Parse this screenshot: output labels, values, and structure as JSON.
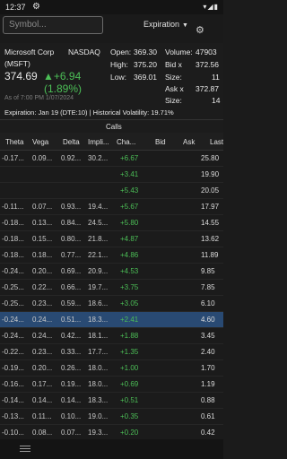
{
  "status": {
    "time": "12:37",
    "right": "▾◢▮"
  },
  "search": {
    "placeholder": "Symbol..."
  },
  "expiration": {
    "label": "Expiration"
  },
  "quote": {
    "company": "Microsoft Corp",
    "exchange": "NASDAQ",
    "ticker": "(MSFT)",
    "price": "374.69",
    "change": "▲+6.94",
    "change_pct": "(1.89%)",
    "asof": "As of  7:00 PM 1/07/2024",
    "open_label": "Open:",
    "open": "369.30",
    "high_label": "High:",
    "high": "375.20",
    "low_label": "Low:",
    "low": "369.01",
    "volume_label": "Volume:",
    "volume": "47903",
    "bid_label": "Bid x",
    "bid": "372.56",
    "size_label": "Size:",
    "size1": "11",
    "ask_label": "Ask x",
    "ask": "372.87",
    "size2": "14",
    "expiration_info": "Expiration: Jan 19 (DTE:10) | Historical Volatility: 19.71%"
  },
  "table": {
    "section": "Calls",
    "headers": [
      "Theta",
      "Vega",
      "Delta",
      "Impli...",
      "Cha...",
      "Bid",
      "Ask",
      "Last"
    ],
    "rows": [
      {
        "theta": "-0.17...",
        "vega": "0.09...",
        "delta": "0.92...",
        "iv": "30.2...",
        "chg": "+6.67",
        "last": "25.80"
      },
      {
        "theta": "",
        "vega": "",
        "delta": "",
        "iv": "",
        "chg": "+3.41",
        "last": "19.90"
      },
      {
        "theta": "",
        "vega": "",
        "delta": "",
        "iv": "",
        "chg": "+5.43",
        "last": "20.05"
      },
      {
        "theta": "-0.11...",
        "vega": "0.07...",
        "delta": "0.93...",
        "iv": "19.4...",
        "chg": "+5.67",
        "last": "17.97"
      },
      {
        "theta": "-0.18...",
        "vega": "0.13...",
        "delta": "0.84...",
        "iv": "24.5...",
        "chg": "+5.80",
        "last": "14.55"
      },
      {
        "theta": "-0.18...",
        "vega": "0.15...",
        "delta": "0.80...",
        "iv": "21.8...",
        "chg": "+4.87",
        "last": "13.62"
      },
      {
        "theta": "-0.18...",
        "vega": "0.18...",
        "delta": "0.77...",
        "iv": "22.1...",
        "chg": "+4.86",
        "last": "11.89"
      },
      {
        "theta": "-0.24...",
        "vega": "0.20...",
        "delta": "0.69...",
        "iv": "20.9...",
        "chg": "+4.53",
        "last": "9.85"
      },
      {
        "theta": "-0.25...",
        "vega": "0.22...",
        "delta": "0.66...",
        "iv": "19.7...",
        "chg": "+3.75",
        "last": "7.85"
      },
      {
        "theta": "-0.25...",
        "vega": "0.23...",
        "delta": "0.59...",
        "iv": "18.6...",
        "chg": "+3.05",
        "last": "6.10"
      },
      {
        "theta": "-0.24...",
        "vega": "0.24...",
        "delta": "0.51...",
        "iv": "18.3...",
        "chg": "+2.41",
        "last": "4.60",
        "selected": true
      },
      {
        "theta": "-0.24...",
        "vega": "0.24...",
        "delta": "0.42...",
        "iv": "18.1...",
        "chg": "+1.88",
        "last": "3.45"
      },
      {
        "theta": "-0.22...",
        "vega": "0.23...",
        "delta": "0.33...",
        "iv": "17.7...",
        "chg": "+1.35",
        "last": "2.40"
      },
      {
        "theta": "-0.19...",
        "vega": "0.20...",
        "delta": "0.26...",
        "iv": "18.0...",
        "chg": "+1.00",
        "last": "1.70"
      },
      {
        "theta": "-0.16...",
        "vega": "0.17...",
        "delta": "0.19...",
        "iv": "18.0...",
        "chg": "+0.69",
        "last": "1.19"
      },
      {
        "theta": "-0.14...",
        "vega": "0.14...",
        "delta": "0.14...",
        "iv": "18.3...",
        "chg": "+0.51",
        "last": "0.88"
      },
      {
        "theta": "-0.13...",
        "vega": "0.11...",
        "delta": "0.10...",
        "iv": "19.0...",
        "chg": "+0.35",
        "last": "0.61"
      },
      {
        "theta": "-0.10...",
        "vega": "0.08...",
        "delta": "0.07...",
        "iv": "19.3...",
        "chg": "+0.20",
        "last": "0.42"
      }
    ]
  }
}
